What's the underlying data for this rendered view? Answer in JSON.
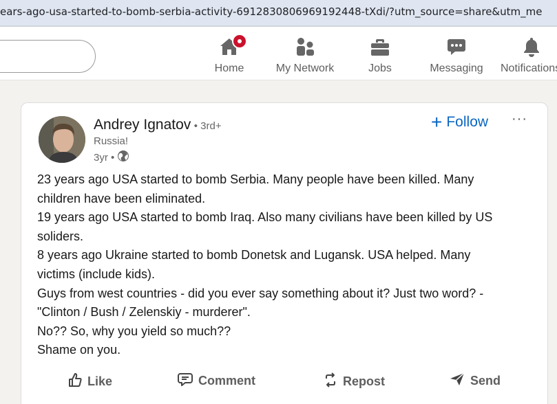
{
  "browser": {
    "url": "ears-ago-usa-started-to-bomb-serbia-activity-6912830806969192448-tXdi/?utm_source=share&utm_me"
  },
  "nav": {
    "items": [
      {
        "label": "Home",
        "icon": "home-icon"
      },
      {
        "label": "My Network",
        "icon": "people-icon"
      },
      {
        "label": "Jobs",
        "icon": "briefcase-icon"
      },
      {
        "label": "Messaging",
        "icon": "chat-icon"
      },
      {
        "label": "Notifications",
        "icon": "bell-icon"
      }
    ],
    "notification_dot": true
  },
  "post": {
    "author": {
      "name": "Andrey Ignatov",
      "degree": "• 3rd+",
      "headline": "Russia!",
      "time": "3yr •"
    },
    "follow_label": "Follow",
    "more_label": "···",
    "text_lines": [
      "23 years ago USA started to bomb Serbia. Many people have been killed. Many",
      "children have been eliminated.",
      "19 years ago USA started to bomb Iraq. Also many civilians have been killed by US",
      "soliders.",
      "8 years ago Ukraine started to bomb Donetsk and Lugansk. USA helped. Many",
      "victims (include kids).",
      "Guys from west countries - did you ever say something about it? Just two word? -",
      "\"Clinton / Bush / Zelenskiy - murderer\".",
      "No?? So, why you yield so much??",
      "Shame on you."
    ],
    "actions": {
      "like": "Like",
      "comment": "Comment",
      "repost": "Repost",
      "send": "Send"
    }
  },
  "colors": {
    "accent": "#0a66c2",
    "badge": "#cb112d",
    "icon_gray": "#666666"
  }
}
